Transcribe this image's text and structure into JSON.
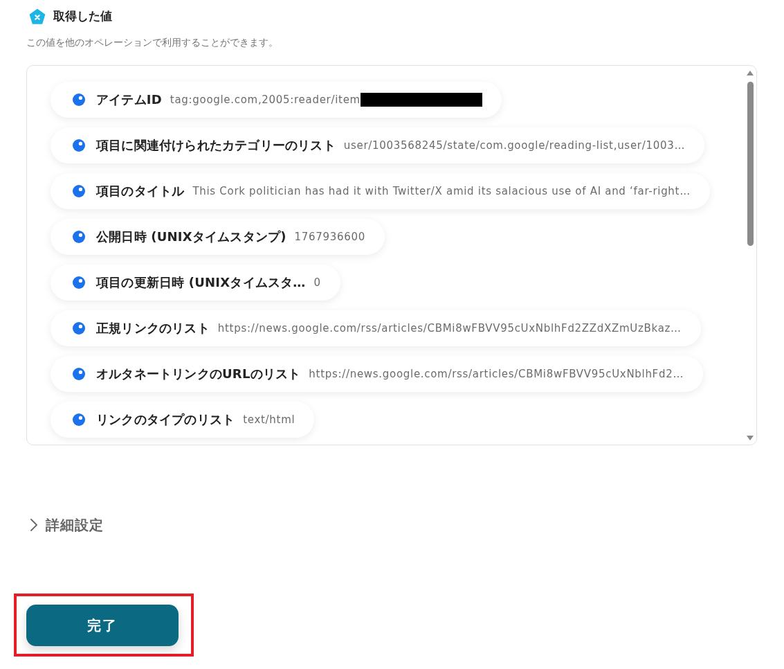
{
  "header": {
    "title": "取得した値",
    "description": "この値を他のオペレーションで利用することができます。"
  },
  "values": [
    {
      "label": "アイテムID",
      "value": "tag:google.com,2005:reader/item",
      "redacted": true
    },
    {
      "label": "項目に関連付けられたカテゴリーのリスト",
      "value": "user/1003568245/state/com.google/reading-list,user/1003…",
      "redacted": false
    },
    {
      "label": "項目のタイトル",
      "value": "This Cork politician has had it with Twitter/X amid its salacious use of AI and ‘far-right…",
      "redacted": false
    },
    {
      "label": "公開日時 (UNIXタイムスタンプ)",
      "value": "1767936600",
      "redacted": false
    },
    {
      "label": "項目の更新日時 (UNIXタイムスタ…",
      "value": "0",
      "redacted": false
    },
    {
      "label": "正規リンクのリスト",
      "value": "https://news.google.com/rss/articles/CBMi8wFBVV95cUxNblhFd2ZZdXZmUzBkaz…",
      "redacted": false
    },
    {
      "label": "オルタネートリンクのURLのリスト",
      "value": "https://news.google.com/rss/articles/CBMi8wFBVV95cUxNblhFd2…",
      "redacted": false
    },
    {
      "label": "リンクのタイプのリスト",
      "value": "text/html",
      "redacted": false
    }
  ],
  "details": {
    "label": "詳細設定",
    "expanded": false
  },
  "button": {
    "label": "完了",
    "highlighted": true
  }
}
